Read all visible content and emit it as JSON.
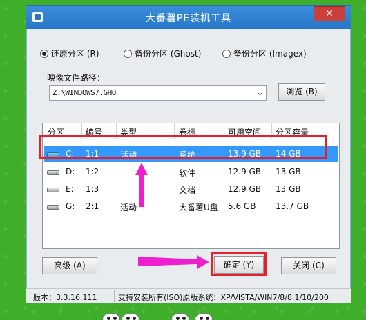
{
  "window": {
    "title": "大番薯PE装机工具",
    "close_symbol": "✕"
  },
  "mode_radios": [
    {
      "label": "还原分区 (R)",
      "selected": true
    },
    {
      "label": "备份分区 (Ghost)",
      "selected": false
    },
    {
      "label": "备份分区 (Imagex)",
      "selected": false
    }
  ],
  "image_path": {
    "label": "映像文件路径：",
    "value": "Z:\\WINDOWS7.GHO",
    "browse_label": "浏览 (B)"
  },
  "partition_table": {
    "columns": [
      "分区",
      "编号",
      "类型",
      "卷标",
      "可用空间",
      "分区容量"
    ],
    "rows": [
      {
        "drive": "C:",
        "number": "1:1",
        "type": "活动",
        "label": "系统",
        "free": "13.9 GB",
        "capacity": "14 GB",
        "selected": true,
        "icon": "hard-drive-icon"
      },
      {
        "drive": "D:",
        "number": "1:2",
        "type": "",
        "label": "软件",
        "free": "12.9 GB",
        "capacity": "13 GB",
        "selected": false,
        "icon": "hard-drive-icon"
      },
      {
        "drive": "E:",
        "number": "1:3",
        "type": "",
        "label": "文档",
        "free": "12.9 GB",
        "capacity": "13 GB",
        "selected": false,
        "icon": "hard-drive-icon"
      },
      {
        "drive": "G:",
        "number": "2:1",
        "type": "活动",
        "label": "大番薯U盘",
        "free": "5.6 GB",
        "capacity": "13.7 GB",
        "selected": false,
        "icon": "usb-drive-icon"
      }
    ]
  },
  "buttons": {
    "advanced": "高级 (A)",
    "ok": "确定 (Y)",
    "close": "关闭 (C)"
  },
  "status": {
    "version": "版本：3.3.16.111",
    "support": "支持安装所有(ISO)原版系统：XP/VISTA/WIN7/8/8.1/10/200"
  },
  "colors": {
    "titlebar": "#2f80d0",
    "selection": "#3399ff",
    "annotation_box": "#e5202b",
    "annotation_arrow": "#ee1fcf",
    "background": "#3fae2a"
  }
}
